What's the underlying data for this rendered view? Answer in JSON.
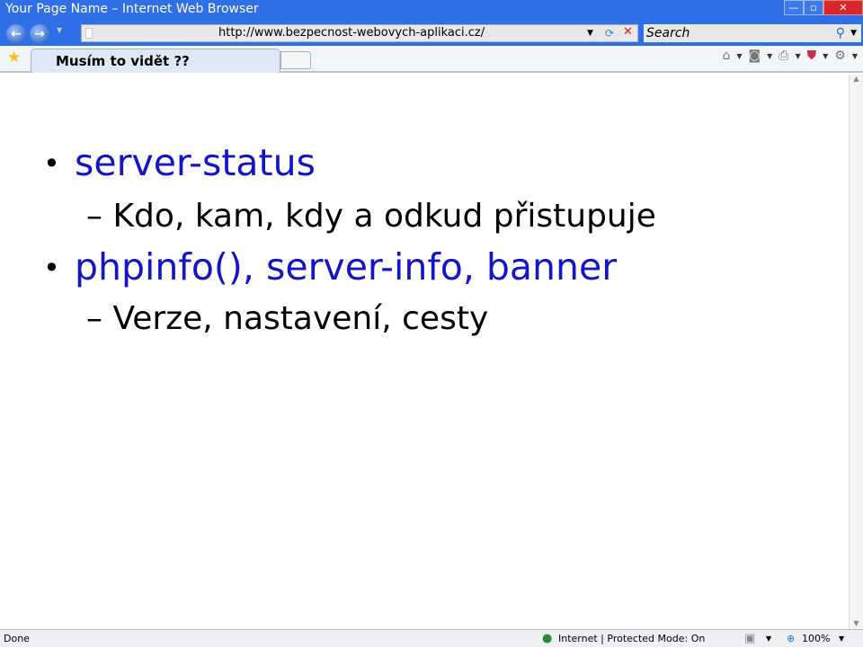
{
  "window": {
    "title": "Your Page Name – Internet Web Browser",
    "minimize": "—",
    "restore": "▫",
    "close": "✕"
  },
  "nav": {
    "url": "http://www.bezpecnost-webovych-aplikaci.cz/",
    "search_placeholder": "Search"
  },
  "tab": {
    "title": "Musím to vidět ??"
  },
  "slide": {
    "items": [
      {
        "text": "server-status",
        "sub": "Kdo, kam, kdy a odkud přistupuje"
      },
      {
        "text": "phpinfo(), server-info, banner",
        "sub": "Verze, nastavení, cesty"
      }
    ]
  },
  "status": {
    "left": "Done",
    "zone": "Internet | Protected Mode: On",
    "zoom": "100%"
  }
}
